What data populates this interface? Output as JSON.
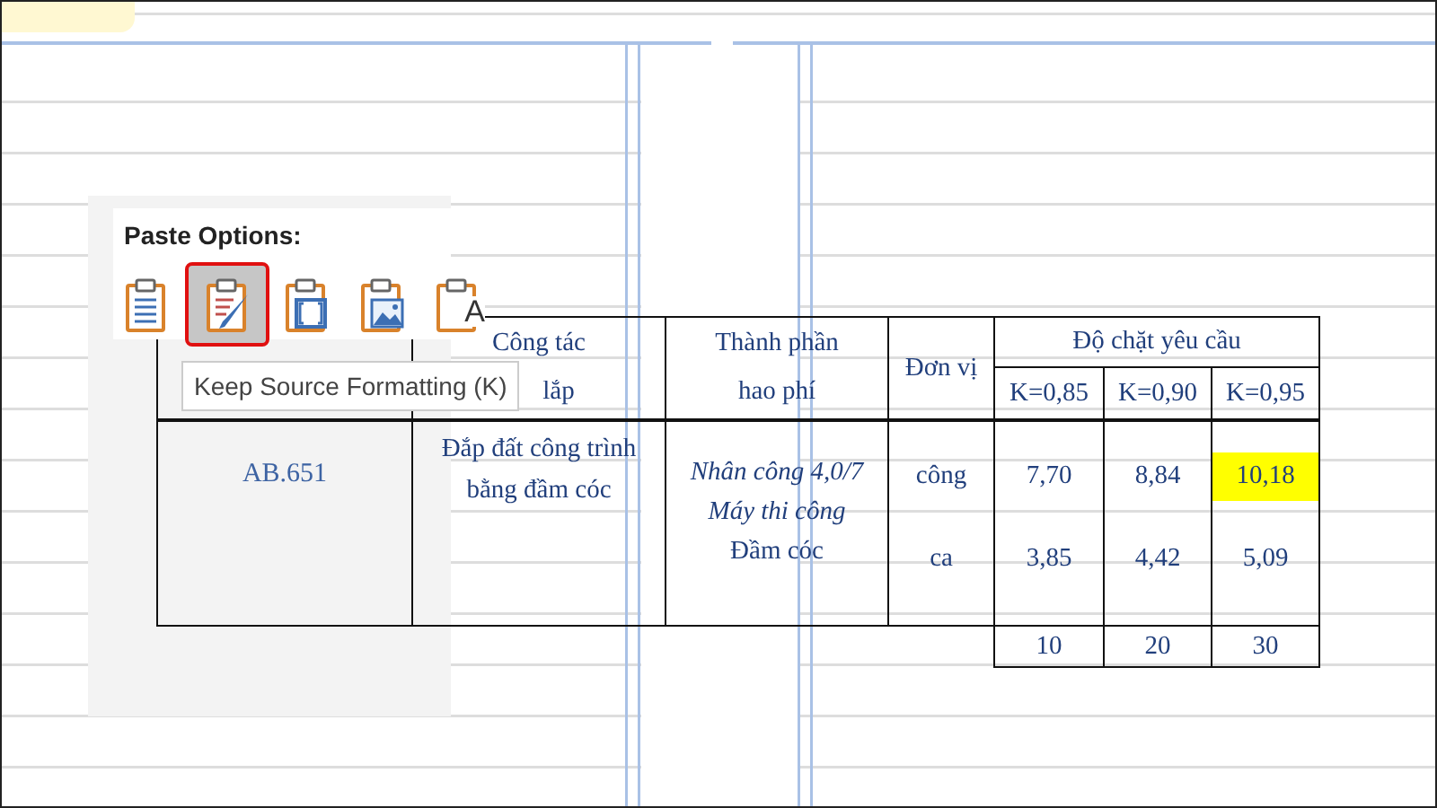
{
  "paste_options": {
    "title": "Paste Options:",
    "options": [
      {
        "kind": "paste",
        "selected": false
      },
      {
        "kind": "keep_source",
        "selected": true
      },
      {
        "kind": "merge",
        "selected": false
      },
      {
        "kind": "picture",
        "selected": false
      },
      {
        "kind": "text",
        "selected": false,
        "glyph": "A"
      }
    ],
    "tooltip": "Keep Source Formatting (K)"
  },
  "table": {
    "header": {
      "work": [
        "Công tác",
        "lắp"
      ],
      "component": [
        "Thành phần",
        "hao phí"
      ],
      "unit": "Đơn vị",
      "group": "Độ chặt yêu cầu",
      "columns": [
        "K=0,85",
        "K=0,90",
        "K=0,95"
      ]
    },
    "body": {
      "code": "AB.651",
      "work": [
        "Đắp đất công trình",
        "bằng đầm cóc"
      ],
      "components": [
        {
          "text": "Nhân công 4,0/7",
          "kind": "italic"
        },
        {
          "text": "Máy thi công",
          "kind": "italic"
        },
        {
          "text": "Đầm cóc",
          "kind": "normal"
        }
      ],
      "rows": [
        {
          "unit": "công",
          "values": [
            {
              "text": "7,70",
              "highlighted": false
            },
            {
              "text": "8,84",
              "highlighted": false
            },
            {
              "text": "10,18",
              "highlighted": true
            }
          ]
        },
        {
          "unit": "ca",
          "values": [
            {
              "text": "3,85",
              "highlighted": false
            },
            {
              "text": "4,42",
              "highlighted": false
            },
            {
              "text": "5,09",
              "highlighted": false
            }
          ]
        }
      ]
    },
    "footer": [
      "10",
      "20",
      "30"
    ]
  }
}
